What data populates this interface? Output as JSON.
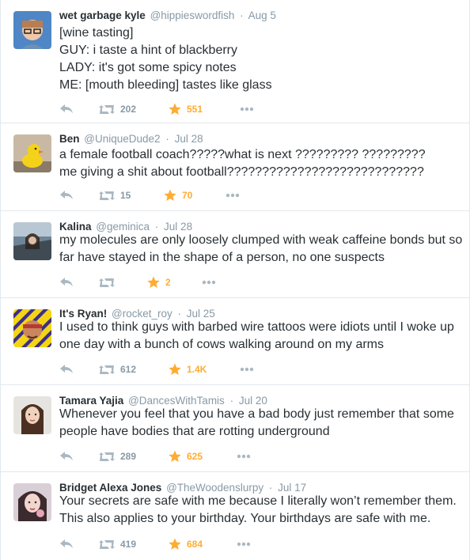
{
  "colors": {
    "favorite": "#ffac33",
    "action_gray": "#aab8c2",
    "meta_gray": "#8899a6",
    "text": "#292f33",
    "border": "#e1e8ed"
  },
  "icons": {
    "reply": "reply-icon",
    "retweet": "retweet-icon",
    "favorite": "star-icon",
    "more": "more-dots-icon"
  },
  "tweets": [
    {
      "fullname": "wet garbage kyle",
      "username": "@hippieswordfish",
      "time": "Aug 5",
      "text": "[wine tasting]\nGUY: i taste a hint of blackberry\nLADY: it's got some spicy notes\nME: [mouth bleeding] tastes like glass",
      "retweets": "202",
      "favorites": "551"
    },
    {
      "fullname": "Ben",
      "username": "@UniqueDude2",
      "time": "Jul 28",
      "text": "a female football coach?????what   is     next ????????? ?????????\nme giving a shit about football????????????????????????????",
      "retweets": "15",
      "favorites": "70"
    },
    {
      "fullname": "Kalina",
      "username": "@geminica",
      "time": "Jul 28",
      "text": "my molecules are only loosely clumped with weak caffeine bonds but so far have stayed in the shape of a person, no one suspects",
      "retweets": "",
      "favorites": "2"
    },
    {
      "fullname": "It's Ryan!",
      "username": "@rocket_roy",
      "time": "Jul 25",
      "text": "I used to think guys with barbed wire tattoos were idiots until I woke up one day with a bunch of cows walking around on my arms",
      "retweets": "612",
      "favorites": "1.4K"
    },
    {
      "fullname": "Tamara Yajia",
      "username": "@DancesWithTamis",
      "time": "Jul 20",
      "text": "Whenever you feel that you have a bad body just remember that some people have bodies that are rotting underground",
      "retweets": "289",
      "favorites": "625"
    },
    {
      "fullname": "Bridget Alexa Jones",
      "username": "@TheWoodenslurpy",
      "time": "Jul 17",
      "text": "Your secrets are safe with me because I literally won’t remember them. This also applies to your birthday. Your birthdays are safe with me.",
      "retweets": "419",
      "favorites": "684"
    }
  ]
}
